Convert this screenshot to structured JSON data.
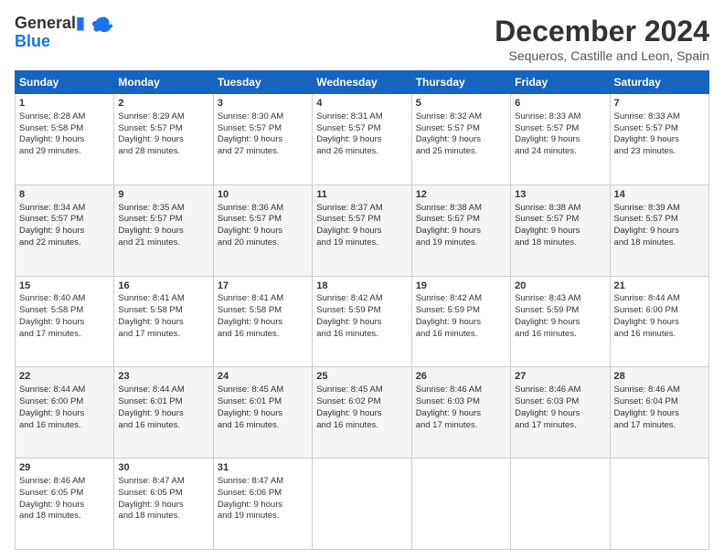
{
  "header": {
    "logo_line1": "General",
    "logo_line2": "Blue",
    "title": "December 2024",
    "subtitle": "Sequeros, Castille and Leon, Spain"
  },
  "columns": [
    "Sunday",
    "Monday",
    "Tuesday",
    "Wednesday",
    "Thursday",
    "Friday",
    "Saturday"
  ],
  "weeks": [
    [
      {
        "day": "1",
        "lines": [
          "Sunrise: 8:28 AM",
          "Sunset: 5:58 PM",
          "Daylight: 9 hours",
          "and 29 minutes."
        ]
      },
      {
        "day": "2",
        "lines": [
          "Sunrise: 8:29 AM",
          "Sunset: 5:57 PM",
          "Daylight: 9 hours",
          "and 28 minutes."
        ]
      },
      {
        "day": "3",
        "lines": [
          "Sunrise: 8:30 AM",
          "Sunset: 5:57 PM",
          "Daylight: 9 hours",
          "and 27 minutes."
        ]
      },
      {
        "day": "4",
        "lines": [
          "Sunrise: 8:31 AM",
          "Sunset: 5:57 PM",
          "Daylight: 9 hours",
          "and 26 minutes."
        ]
      },
      {
        "day": "5",
        "lines": [
          "Sunrise: 8:32 AM",
          "Sunset: 5:57 PM",
          "Daylight: 9 hours",
          "and 25 minutes."
        ]
      },
      {
        "day": "6",
        "lines": [
          "Sunrise: 8:33 AM",
          "Sunset: 5:57 PM",
          "Daylight: 9 hours",
          "and 24 minutes."
        ]
      },
      {
        "day": "7",
        "lines": [
          "Sunrise: 8:33 AM",
          "Sunset: 5:57 PM",
          "Daylight: 9 hours",
          "and 23 minutes."
        ]
      }
    ],
    [
      {
        "day": "8",
        "lines": [
          "Sunrise: 8:34 AM",
          "Sunset: 5:57 PM",
          "Daylight: 9 hours",
          "and 22 minutes."
        ]
      },
      {
        "day": "9",
        "lines": [
          "Sunrise: 8:35 AM",
          "Sunset: 5:57 PM",
          "Daylight: 9 hours",
          "and 21 minutes."
        ]
      },
      {
        "day": "10",
        "lines": [
          "Sunrise: 8:36 AM",
          "Sunset: 5:57 PM",
          "Daylight: 9 hours",
          "and 20 minutes."
        ]
      },
      {
        "day": "11",
        "lines": [
          "Sunrise: 8:37 AM",
          "Sunset: 5:57 PM",
          "Daylight: 9 hours",
          "and 19 minutes."
        ]
      },
      {
        "day": "12",
        "lines": [
          "Sunrise: 8:38 AM",
          "Sunset: 5:57 PM",
          "Daylight: 9 hours",
          "and 19 minutes."
        ]
      },
      {
        "day": "13",
        "lines": [
          "Sunrise: 8:38 AM",
          "Sunset: 5:57 PM",
          "Daylight: 9 hours",
          "and 18 minutes."
        ]
      },
      {
        "day": "14",
        "lines": [
          "Sunrise: 8:39 AM",
          "Sunset: 5:57 PM",
          "Daylight: 9 hours",
          "and 18 minutes."
        ]
      }
    ],
    [
      {
        "day": "15",
        "lines": [
          "Sunrise: 8:40 AM",
          "Sunset: 5:58 PM",
          "Daylight: 9 hours",
          "and 17 minutes."
        ]
      },
      {
        "day": "16",
        "lines": [
          "Sunrise: 8:41 AM",
          "Sunset: 5:58 PM",
          "Daylight: 9 hours",
          "and 17 minutes."
        ]
      },
      {
        "day": "17",
        "lines": [
          "Sunrise: 8:41 AM",
          "Sunset: 5:58 PM",
          "Daylight: 9 hours",
          "and 16 minutes."
        ]
      },
      {
        "day": "18",
        "lines": [
          "Sunrise: 8:42 AM",
          "Sunset: 5:59 PM",
          "Daylight: 9 hours",
          "and 16 minutes."
        ]
      },
      {
        "day": "19",
        "lines": [
          "Sunrise: 8:42 AM",
          "Sunset: 5:59 PM",
          "Daylight: 9 hours",
          "and 16 minutes."
        ]
      },
      {
        "day": "20",
        "lines": [
          "Sunrise: 8:43 AM",
          "Sunset: 5:59 PM",
          "Daylight: 9 hours",
          "and 16 minutes."
        ]
      },
      {
        "day": "21",
        "lines": [
          "Sunrise: 8:44 AM",
          "Sunset: 6:00 PM",
          "Daylight: 9 hours",
          "and 16 minutes."
        ]
      }
    ],
    [
      {
        "day": "22",
        "lines": [
          "Sunrise: 8:44 AM",
          "Sunset: 6:00 PM",
          "Daylight: 9 hours",
          "and 16 minutes."
        ]
      },
      {
        "day": "23",
        "lines": [
          "Sunrise: 8:44 AM",
          "Sunset: 6:01 PM",
          "Daylight: 9 hours",
          "and 16 minutes."
        ]
      },
      {
        "day": "24",
        "lines": [
          "Sunrise: 8:45 AM",
          "Sunset: 6:01 PM",
          "Daylight: 9 hours",
          "and 16 minutes."
        ]
      },
      {
        "day": "25",
        "lines": [
          "Sunrise: 8:45 AM",
          "Sunset: 6:02 PM",
          "Daylight: 9 hours",
          "and 16 minutes."
        ]
      },
      {
        "day": "26",
        "lines": [
          "Sunrise: 8:46 AM",
          "Sunset: 6:03 PM",
          "Daylight: 9 hours",
          "and 17 minutes."
        ]
      },
      {
        "day": "27",
        "lines": [
          "Sunrise: 8:46 AM",
          "Sunset: 6:03 PM",
          "Daylight: 9 hours",
          "and 17 minutes."
        ]
      },
      {
        "day": "28",
        "lines": [
          "Sunrise: 8:46 AM",
          "Sunset: 6:04 PM",
          "Daylight: 9 hours",
          "and 17 minutes."
        ]
      }
    ],
    [
      {
        "day": "29",
        "lines": [
          "Sunrise: 8:46 AM",
          "Sunset: 6:05 PM",
          "Daylight: 9 hours",
          "and 18 minutes."
        ]
      },
      {
        "day": "30",
        "lines": [
          "Sunrise: 8:47 AM",
          "Sunset: 6:05 PM",
          "Daylight: 9 hours",
          "and 18 minutes."
        ]
      },
      {
        "day": "31",
        "lines": [
          "Sunrise: 8:47 AM",
          "Sunset: 6:06 PM",
          "Daylight: 9 hours",
          "and 19 minutes."
        ]
      },
      {
        "day": "",
        "lines": []
      },
      {
        "day": "",
        "lines": []
      },
      {
        "day": "",
        "lines": []
      },
      {
        "day": "",
        "lines": []
      }
    ]
  ]
}
